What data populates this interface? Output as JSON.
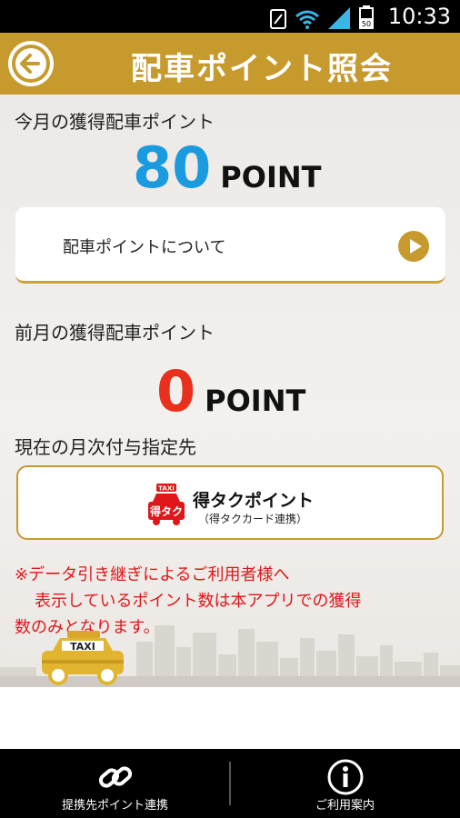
{
  "status_bar": {
    "time": "10:33",
    "battery": "50"
  },
  "header": {
    "title": "配車ポイント照会"
  },
  "current_month": {
    "label": "今月の獲得配車ポイント",
    "points": "80",
    "unit": "POINT"
  },
  "about_button": {
    "label": "配車ポイントについて"
  },
  "previous_month": {
    "label": "前月の獲得配車ポイント",
    "points": "0",
    "unit": "POINT"
  },
  "destination": {
    "label": "現在の月次付与指定先",
    "name": "得タクポイント",
    "subtitle": "（得タクカード連携）",
    "logo_text_top": "TAXI",
    "logo_text": "得タク"
  },
  "notice": {
    "line1": "※データ引き継ぎによるご利用者様へ",
    "line2": "表示しているポイント数は本アプリでの獲得",
    "line3": "数のみとなります。"
  },
  "taxi_sign": "TAXI",
  "bottom_nav": {
    "link_label": "提携先ポイント連携",
    "info_label": "ご利用案内"
  },
  "colors": {
    "accent": "#c79a2e",
    "current_points": "#1a9be0",
    "previous_points": "#e8301c",
    "notice": "#e0161a"
  }
}
